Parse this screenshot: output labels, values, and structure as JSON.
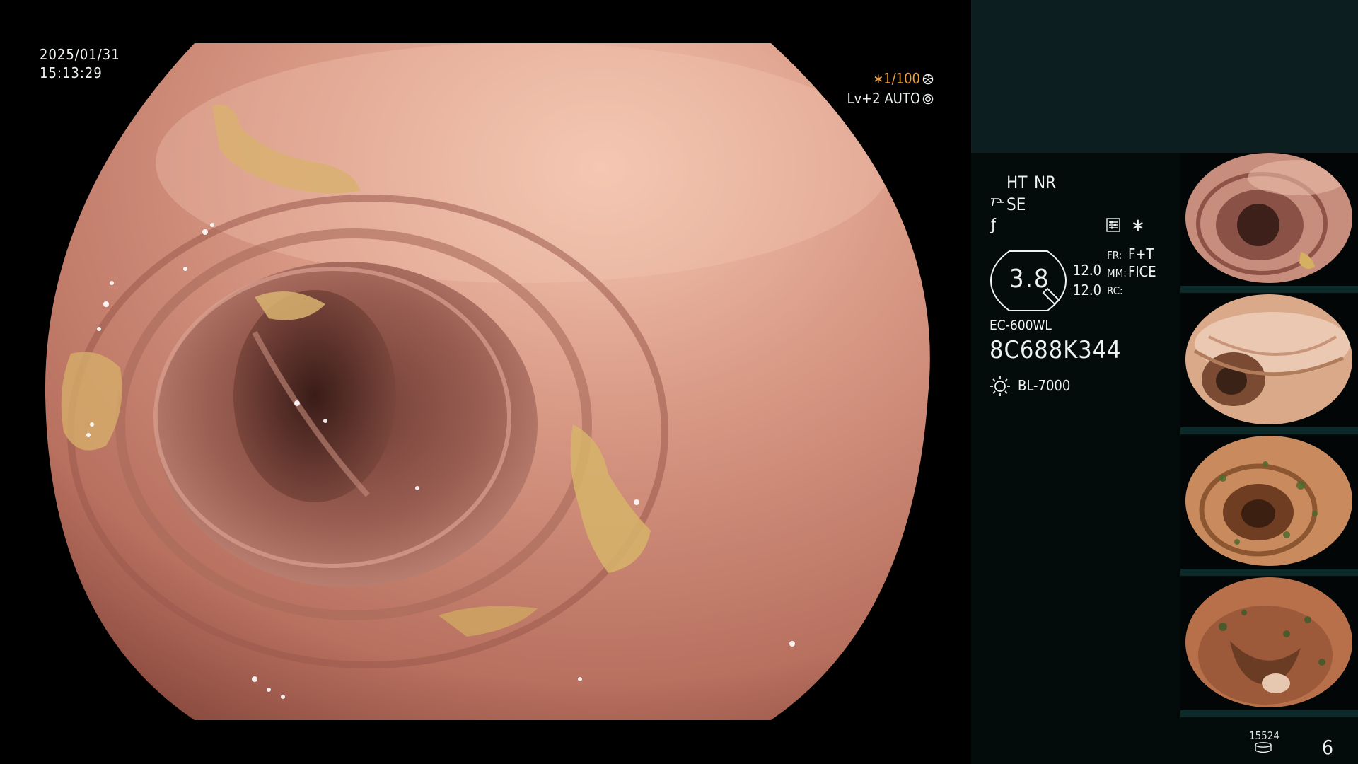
{
  "overlay": {
    "date": "2025/01/31",
    "time": "15:13:29",
    "shutter": "∗1/100",
    "shutter_icon": "aperture-icon",
    "level": "Lv+2 AUTO",
    "level_icon": "auto-iris-icon"
  },
  "panel": {
    "ht": "HT",
    "nr": "NR",
    "se": "SE",
    "se_icon": "structure-enhance-icon",
    "f_icon": "f-symbol-icon",
    "menu_icon": "settings-list-icon",
    "star": "∗",
    "zoom": "3.8",
    "mm_values": [
      "12.0",
      "12.0"
    ],
    "fr_label": "FR:",
    "fr_value": "F+T",
    "mm_label": "MM:",
    "mm_value": "FICE",
    "rc_label": "RC:",
    "scope_model": "EC-600WL",
    "serial": "8C688K344",
    "light_icon": "lamp-icon",
    "light_source": "BL-7000",
    "count_small": "15524",
    "count_icon": "disk-icon",
    "image_count": "6"
  },
  "thumbnails": [
    {
      "name": "captured-image-1"
    },
    {
      "name": "captured-image-2"
    },
    {
      "name": "captured-image-3"
    },
    {
      "name": "captured-image-4"
    }
  ],
  "colors": {
    "accent": "#f0a040",
    "panel_bg": "#040b0b",
    "panel_top": "#0c1e1f"
  }
}
